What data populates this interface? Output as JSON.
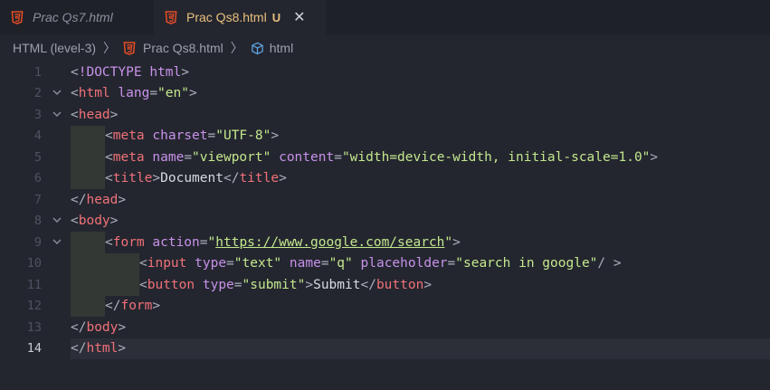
{
  "tabs": [
    {
      "label": "Prac Qs7.html",
      "active": false
    },
    {
      "label": "Prac Qs8.html",
      "active": true,
      "badge": "U",
      "close": "✕"
    }
  ],
  "breadcrumb": {
    "items": [
      "HTML (level-3)",
      "Prac Qs8.html",
      "html"
    ],
    "separator": "〉"
  },
  "colors": {
    "background": "#24262f",
    "html5_icon": "#e44d26",
    "tag": "#f07178",
    "attribute": "#c792ea",
    "string": "#c3e88d",
    "text": "#d7dae0"
  },
  "editor": {
    "current_line": 14,
    "lines": [
      {
        "n": "1",
        "fold": false,
        "indent": 0,
        "tokens": [
          [
            "punct",
            "<"
          ],
          [
            "doctype",
            "!DOCTYPE"
          ],
          [
            "punct",
            " "
          ],
          [
            "attr",
            "html"
          ],
          [
            "punct",
            ">"
          ]
        ]
      },
      {
        "n": "2",
        "fold": true,
        "indent": 0,
        "tokens": [
          [
            "punct",
            "<"
          ],
          [
            "tag",
            "html"
          ],
          [
            "punct",
            " "
          ],
          [
            "attr",
            "lang"
          ],
          [
            "punct",
            "="
          ],
          [
            "str",
            "\"en\""
          ],
          [
            "punct",
            ">"
          ]
        ]
      },
      {
        "n": "3",
        "fold": true,
        "indent": 0,
        "tokens": [
          [
            "punct",
            "<"
          ],
          [
            "tag",
            "head"
          ],
          [
            "punct",
            ">"
          ]
        ]
      },
      {
        "n": "4",
        "fold": false,
        "indent": 1,
        "tokens": [
          [
            "punct",
            "<"
          ],
          [
            "tag",
            "meta"
          ],
          [
            "punct",
            " "
          ],
          [
            "attr",
            "charset"
          ],
          [
            "punct",
            "="
          ],
          [
            "str",
            "\"UTF-8\""
          ],
          [
            "punct",
            ">"
          ]
        ]
      },
      {
        "n": "5",
        "fold": false,
        "indent": 1,
        "tokens": [
          [
            "punct",
            "<"
          ],
          [
            "tag",
            "meta"
          ],
          [
            "punct",
            " "
          ],
          [
            "attr",
            "name"
          ],
          [
            "punct",
            "="
          ],
          [
            "str",
            "\"viewport\""
          ],
          [
            "punct",
            " "
          ],
          [
            "attr",
            "content"
          ],
          [
            "punct",
            "="
          ],
          [
            "str",
            "\"width=device-width, initial-scale=1.0\""
          ],
          [
            "punct",
            ">"
          ]
        ]
      },
      {
        "n": "6",
        "fold": false,
        "indent": 1,
        "tokens": [
          [
            "punct",
            "<"
          ],
          [
            "tag",
            "title"
          ],
          [
            "punct",
            ">"
          ],
          [
            "text",
            "Document"
          ],
          [
            "punct",
            "</"
          ],
          [
            "tag",
            "title"
          ],
          [
            "punct",
            ">"
          ]
        ]
      },
      {
        "n": "7",
        "fold": false,
        "indent": 0,
        "tokens": [
          [
            "punct",
            "</"
          ],
          [
            "tag",
            "head"
          ],
          [
            "punct",
            ">"
          ]
        ]
      },
      {
        "n": "8",
        "fold": true,
        "indent": 0,
        "tokens": [
          [
            "punct",
            "<"
          ],
          [
            "tag",
            "body"
          ],
          [
            "punct",
            ">"
          ]
        ]
      },
      {
        "n": "9",
        "fold": true,
        "indent": 1,
        "tokens": [
          [
            "punct",
            "<"
          ],
          [
            "tag",
            "form"
          ],
          [
            "punct",
            " "
          ],
          [
            "attr",
            "action"
          ],
          [
            "punct",
            "="
          ],
          [
            "str",
            "\""
          ],
          [
            "url",
            "https://www.google.com/search"
          ],
          [
            "str",
            "\""
          ],
          [
            "punct",
            ">"
          ]
        ]
      },
      {
        "n": "10",
        "fold": false,
        "indent": 2,
        "tokens": [
          [
            "punct",
            "<"
          ],
          [
            "tag",
            "input"
          ],
          [
            "punct",
            " "
          ],
          [
            "attr",
            "type"
          ],
          [
            "punct",
            "="
          ],
          [
            "str",
            "\"text\""
          ],
          [
            "punct",
            " "
          ],
          [
            "attr",
            "name"
          ],
          [
            "punct",
            "="
          ],
          [
            "str",
            "\"q\""
          ],
          [
            "punct",
            " "
          ],
          [
            "attr",
            "placeholder"
          ],
          [
            "punct",
            "="
          ],
          [
            "str",
            "\"search in google\""
          ],
          [
            "punct",
            "/ >"
          ]
        ]
      },
      {
        "n": "11",
        "fold": false,
        "indent": 2,
        "tokens": [
          [
            "punct",
            "<"
          ],
          [
            "tag",
            "button"
          ],
          [
            "punct",
            " "
          ],
          [
            "attr",
            "type"
          ],
          [
            "punct",
            "="
          ],
          [
            "str",
            "\"submit\""
          ],
          [
            "punct",
            ">"
          ],
          [
            "text",
            "Submit"
          ],
          [
            "punct",
            "</"
          ],
          [
            "tag",
            "button"
          ],
          [
            "punct",
            ">"
          ]
        ]
      },
      {
        "n": "12",
        "fold": false,
        "indent": 1,
        "tokens": [
          [
            "punct",
            "</"
          ],
          [
            "tag",
            "form"
          ],
          [
            "punct",
            ">"
          ]
        ]
      },
      {
        "n": "13",
        "fold": false,
        "indent": 0,
        "tokens": [
          [
            "punct",
            "</"
          ],
          [
            "tag",
            "body"
          ],
          [
            "punct",
            ">"
          ]
        ]
      },
      {
        "n": "14",
        "fold": false,
        "indent": 0,
        "tokens": [
          [
            "punct",
            "</"
          ],
          [
            "tag",
            "html"
          ],
          [
            "punct",
            ">"
          ]
        ]
      }
    ]
  }
}
